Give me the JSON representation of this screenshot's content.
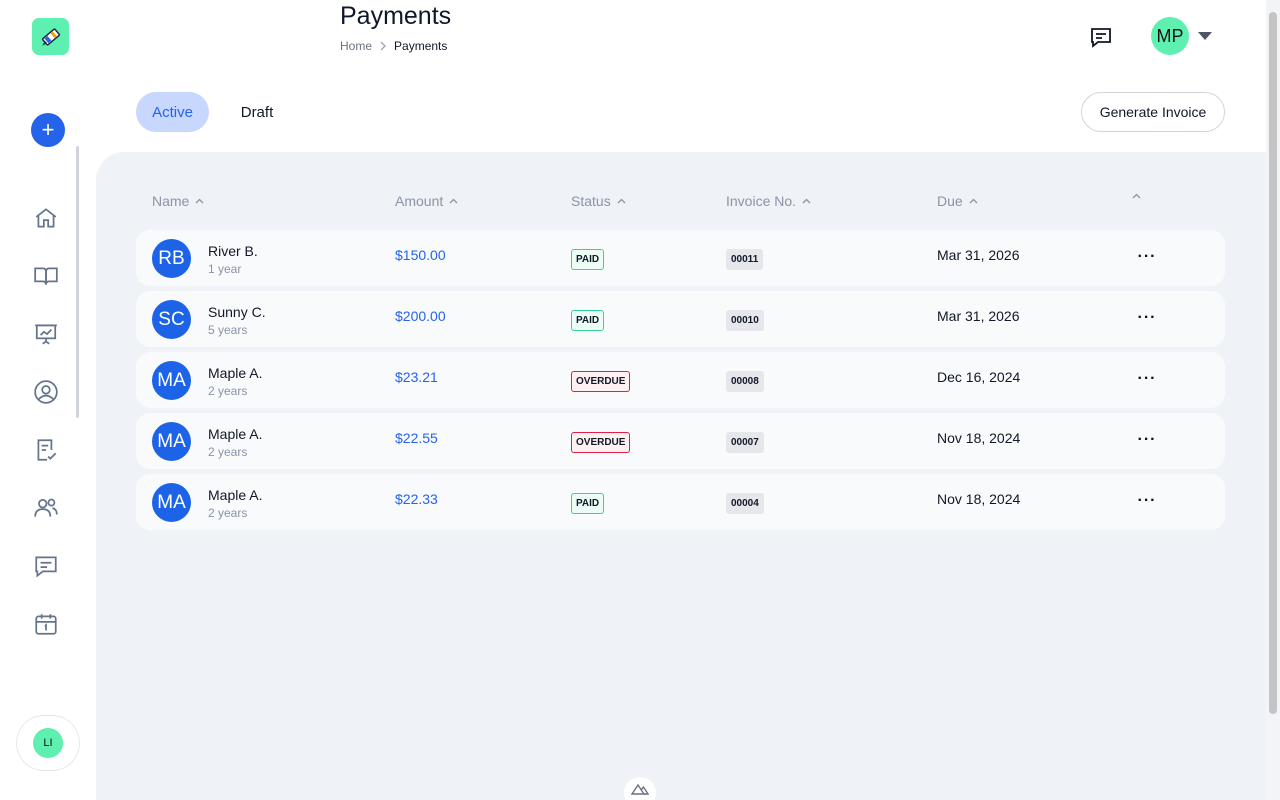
{
  "header": {
    "title": "Payments",
    "breadcrumb": {
      "home": "Home",
      "separator": "›",
      "current": "Payments"
    },
    "user_initials": "MP"
  },
  "sidebar": {
    "add_label": "+",
    "items": [
      {
        "name": "home-icon"
      },
      {
        "name": "book-icon"
      },
      {
        "name": "presentation-chart-icon"
      },
      {
        "name": "user-circle-icon"
      },
      {
        "name": "clipboard-check-icon"
      },
      {
        "name": "users-icon"
      },
      {
        "name": "chat-icon"
      },
      {
        "name": "calendar-icon"
      }
    ],
    "user_initials": "LI"
  },
  "tabs": [
    {
      "label": "Active",
      "active": true
    },
    {
      "label": "Draft",
      "active": false
    }
  ],
  "actions": {
    "generate_invoice": "Generate Invoice"
  },
  "table": {
    "columns": {
      "name": "Name",
      "amount": "Amount",
      "status": "Status",
      "invoice": "Invoice No.",
      "due": "Due"
    },
    "rows": [
      {
        "initials": "RB",
        "name": "River B.",
        "age": "1 year",
        "amount": "$150.00",
        "status": "PAID",
        "invoice": "00011",
        "due": "Mar 31, 2026"
      },
      {
        "initials": "SC",
        "name": "Sunny C.",
        "age": "5 years",
        "amount": "$200.00",
        "status": "PAID",
        "invoice": "00010",
        "due": "Mar 31, 2026"
      },
      {
        "initials": "MA",
        "name": "Maple A.",
        "age": "2 years",
        "amount": "$23.21",
        "status": "OVERDUE",
        "invoice": "00008",
        "due": "Dec 16, 2024"
      },
      {
        "initials": "MA",
        "name": "Maple A.",
        "age": "2 years",
        "amount": "$22.55",
        "status": "OVERDUE",
        "invoice": "00007",
        "due": "Nov 18, 2024"
      },
      {
        "initials": "MA",
        "name": "Maple A.",
        "age": "2 years",
        "amount": "$22.33",
        "status": "PAID",
        "invoice": "00004",
        "due": "Nov 18, 2024"
      }
    ]
  },
  "colors": {
    "accent": "#2563eb",
    "brand_green": "#5ef0b0",
    "paid": "#34d399",
    "overdue": "#e11d48"
  }
}
